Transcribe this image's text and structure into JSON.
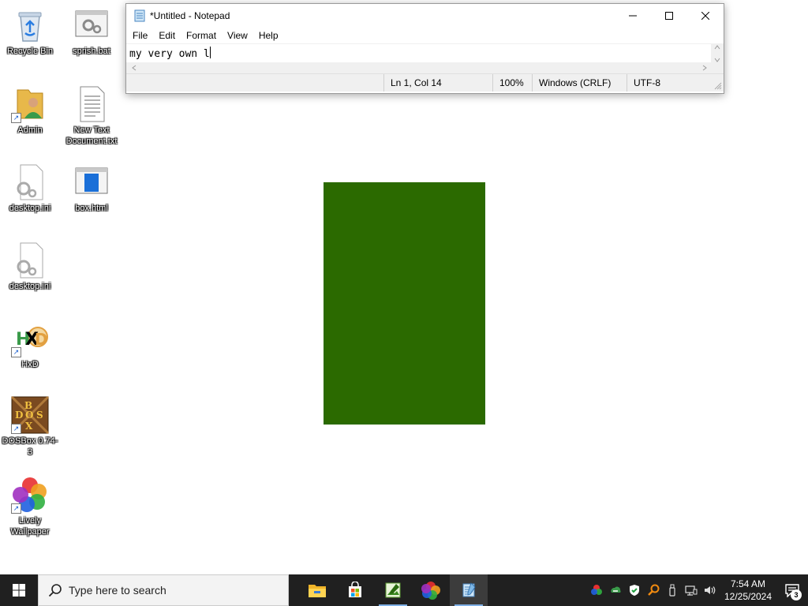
{
  "desktop": {
    "icons": [
      {
        "label": "Recycle Bin",
        "icon": "recycle-bin-icon"
      },
      {
        "label": "sprish.bat",
        "icon": "batch-file-icon"
      },
      {
        "label": "Admin",
        "icon": "user-folder-icon"
      },
      {
        "label": "New Text Document.txt",
        "icon": "text-document-icon"
      },
      {
        "label": "desktop.ini",
        "icon": "settings-file-icon"
      },
      {
        "label": "box.html",
        "icon": "html-file-icon"
      },
      {
        "label": "desktop.ini",
        "icon": "settings-file-icon"
      },
      {
        "label": "HxD",
        "icon": "hxd-icon"
      },
      {
        "label": "DOSBox 0.74-3",
        "icon": "dosbox-icon"
      },
      {
        "label": "Lively Wallpaper",
        "icon": "lively-wallpaper-icon"
      }
    ],
    "box_color": "#2b6a00"
  },
  "notepad": {
    "title": "*Untitled - Notepad",
    "menu": [
      "File",
      "Edit",
      "Format",
      "View",
      "Help"
    ],
    "content": "my very own l",
    "status": {
      "position": "Ln 1, Col 14",
      "zoom": "100%",
      "line_ending": "Windows (CRLF)",
      "encoding": "UTF-8"
    }
  },
  "taskbar": {
    "search_placeholder": "Type here to search",
    "apps": [
      "file-explorer-icon",
      "microsoft-store-icon",
      "image-editor-icon",
      "color-app-icon",
      "notepad-icon"
    ],
    "clock_time": "7:54 AM",
    "clock_date": "12/25/2024",
    "notification_count": "3"
  }
}
